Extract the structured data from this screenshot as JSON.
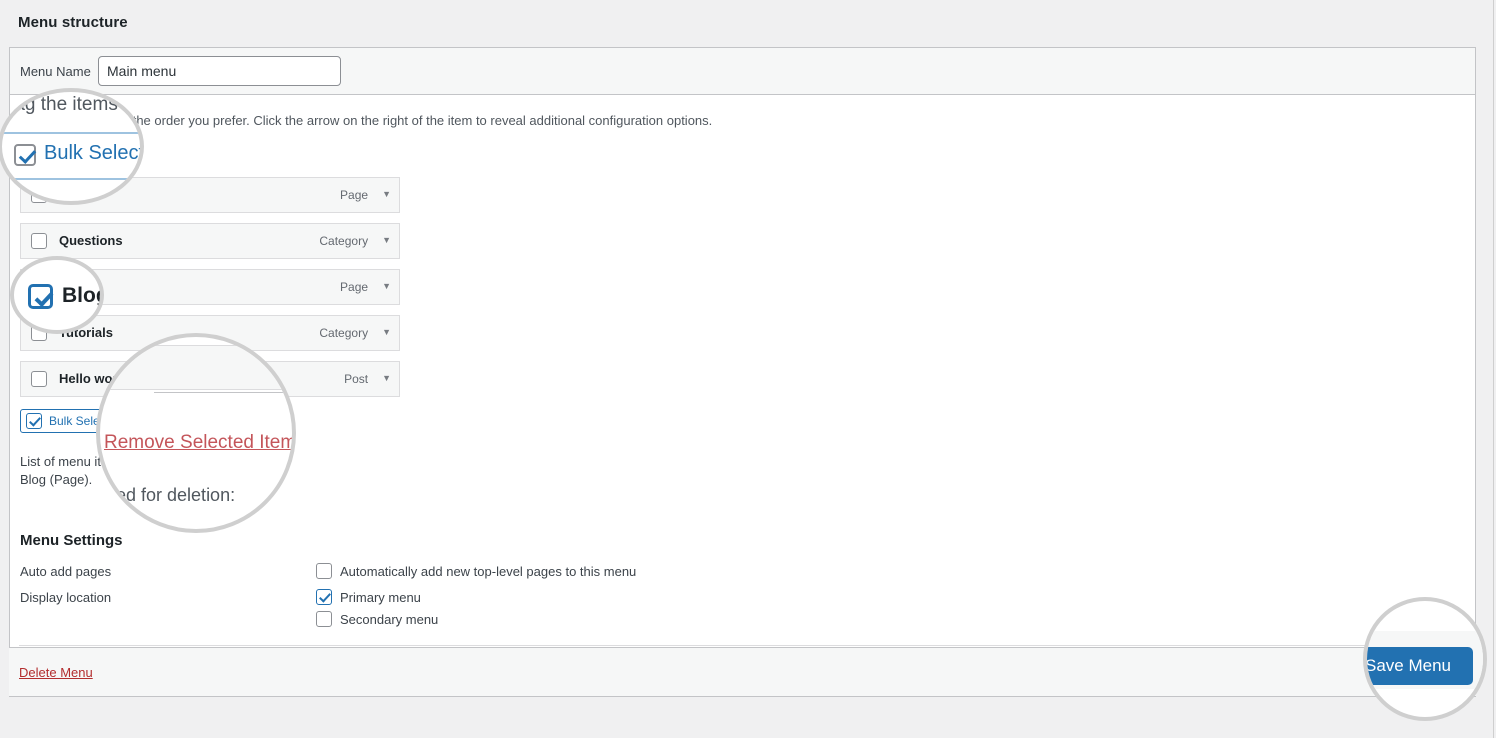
{
  "page": {
    "title": "Menu structure"
  },
  "menu_name": {
    "label": "Menu Name",
    "value": "Main menu",
    "placeholder": "Menu Name"
  },
  "helper_text": "Drag the items into the order you prefer. Click the arrow on the right of the item to reveal additional configuration options.",
  "bulk_select": {
    "top_label": "Bulk Select",
    "bottom_label": "Bulk Select",
    "checked": true
  },
  "remove_selected": {
    "label": "Remove Selected Items"
  },
  "menu_items": [
    {
      "title": "",
      "type": "Page",
      "checked": false,
      "arrow": "▼"
    },
    {
      "title": "Questions",
      "type": "Category",
      "checked": false,
      "arrow": "▼"
    },
    {
      "title": "Blog",
      "type": "Page",
      "checked": true,
      "arrow": "▼"
    },
    {
      "title": "Tutorials",
      "type": "Category",
      "checked": false,
      "arrow": "▼"
    },
    {
      "title": "Hello world",
      "type": "Post",
      "checked": false,
      "arrow": "▼"
    }
  ],
  "deletion_note": {
    "line1": "List of menu items selected for deletion:",
    "line2": "Blog (Page)."
  },
  "settings": {
    "title": "Menu Settings",
    "auto_add": {
      "label": "Auto add pages",
      "option_label": "Automatically add new top-level pages to this menu",
      "checked": false
    },
    "display_location": {
      "label": "Display location",
      "options": [
        {
          "label": "Primary menu",
          "checked": true
        },
        {
          "label": "Secondary menu",
          "checked": false
        }
      ]
    }
  },
  "footer": {
    "delete_menu": "Delete Menu",
    "save_menu": "Save Menu"
  },
  "magnifiers": {
    "one": {
      "text": "rag the items in",
      "checkbox_label": "Bulk Select"
    },
    "two": {
      "label": "Blog"
    },
    "three": {
      "link": "Remove Selected Items",
      "sub": "cted for deletion:"
    },
    "four": {
      "button": "Save Menu"
    }
  },
  "colors": {
    "accent": "#2271b1",
    "danger": "#b32d2e",
    "page_bg": "#f0f0f1",
    "panel_bg": "#ffffff",
    "strip_bg": "#f6f7f7",
    "border": "#c3c4c7"
  }
}
